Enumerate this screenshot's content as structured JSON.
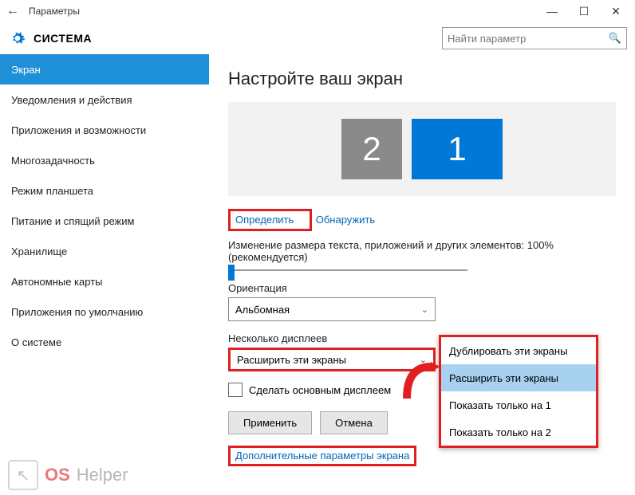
{
  "window": {
    "title": "Параметры"
  },
  "header": {
    "system": "СИСТЕМА",
    "search_placeholder": "Найти параметр"
  },
  "sidebar": {
    "items": [
      "Экран",
      "Уведомления и действия",
      "Приложения и возможности",
      "Многозадачность",
      "Режим планшета",
      "Питание и спящий режим",
      "Хранилище",
      "Автономные карты",
      "Приложения по умолчанию",
      "О системе"
    ],
    "selected": 0
  },
  "main": {
    "heading": "Настройте ваш экран",
    "monitor1": "1",
    "monitor2": "2",
    "identify": "Определить",
    "detect": "Обнаружить",
    "scale_label": "Изменение размера текста, приложений и других элементов: 100% (рекомендуется)",
    "orientation_label": "Ориентация",
    "orientation_value": "Альбомная",
    "multi_label": "Несколько дисплеев",
    "multi_value": "Расширить эти экраны",
    "main_display": "Сделать основным дисплеем",
    "apply": "Применить",
    "cancel": "Отмена",
    "advanced": "Дополнительные параметры экрана"
  },
  "dropdown": {
    "options": [
      "Дублировать эти экраны",
      "Расширить эти экраны",
      "Показать только на 1",
      "Показать только на 2"
    ],
    "selected": 1
  },
  "watermark": {
    "part1": "OS",
    "part2": "Helper"
  }
}
